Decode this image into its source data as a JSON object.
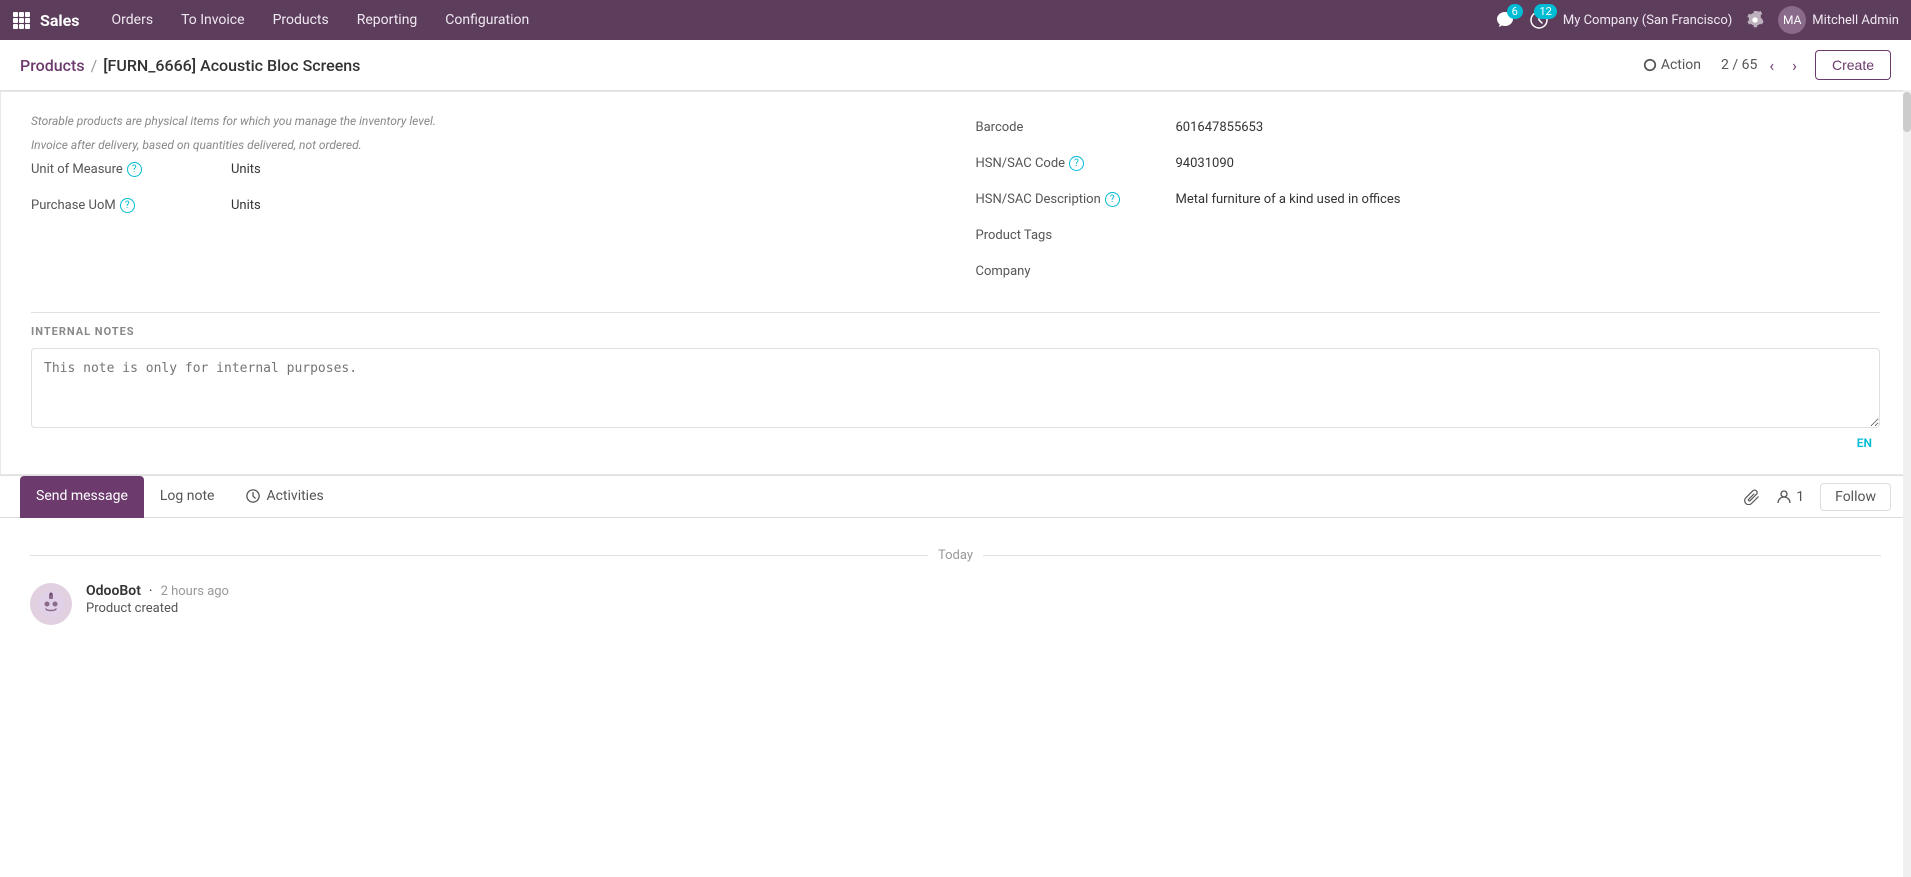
{
  "app": {
    "name": "Sales"
  },
  "topnav": {
    "brand": "Sales",
    "menu_items": [
      "Orders",
      "To Invoice",
      "Products",
      "Reporting",
      "Configuration"
    ],
    "notifications_chat_count": "6",
    "notifications_clock_count": "12",
    "company": "My Company (San Francisco)",
    "user": "Mitchell Admin"
  },
  "titlebar": {
    "breadcrumb_parent": "Products",
    "breadcrumb_sep": "/",
    "breadcrumb_current": "[FURN_6666] Acoustic Bloc Screens",
    "action_label": "Action",
    "pagination_current": "2",
    "pagination_total": "65",
    "create_label": "Create"
  },
  "form": {
    "storable_note1": "Storable products are physical items for which you manage the inventory level.",
    "storable_note2": "Invoice after delivery, based on quantities delivered, not ordered.",
    "unit_of_measure_label": "Unit of Measure",
    "unit_of_measure_value": "Units",
    "purchase_uom_label": "Purchase UoM",
    "purchase_uom_value": "Units",
    "barcode_label": "Barcode",
    "barcode_value": "601647855653",
    "hsn_sac_code_label": "HSN/SAC Code",
    "hsn_sac_code_value": "94031090",
    "hsn_sac_desc_label": "HSN/SAC Description",
    "hsn_sac_desc_value": "Metal furniture of a kind used in offices",
    "product_tags_label": "Product Tags",
    "company_label": "Company",
    "internal_notes_title": "INTERNAL NOTES",
    "internal_notes_placeholder": "This note is only for internal purposes.",
    "lang_indicator": "EN"
  },
  "chatter": {
    "send_message_label": "Send message",
    "log_note_label": "Log note",
    "activities_label": "Activities",
    "followers_count": "1",
    "follow_label": "Follow",
    "date_divider": "Today",
    "message": {
      "author": "OdooBot",
      "time": "2 hours ago",
      "separator": "·",
      "content": "Product created"
    }
  },
  "icons": {
    "apps_grid": "⊞",
    "gear": "⚙",
    "wrench": "🔧",
    "chevron_left": "‹",
    "chevron_right": "›",
    "clock_icon": "⏰",
    "chat_icon": "💬",
    "activity_clock": "⊙",
    "paperclip": "📎",
    "followers": "👤",
    "help_q": "?"
  }
}
